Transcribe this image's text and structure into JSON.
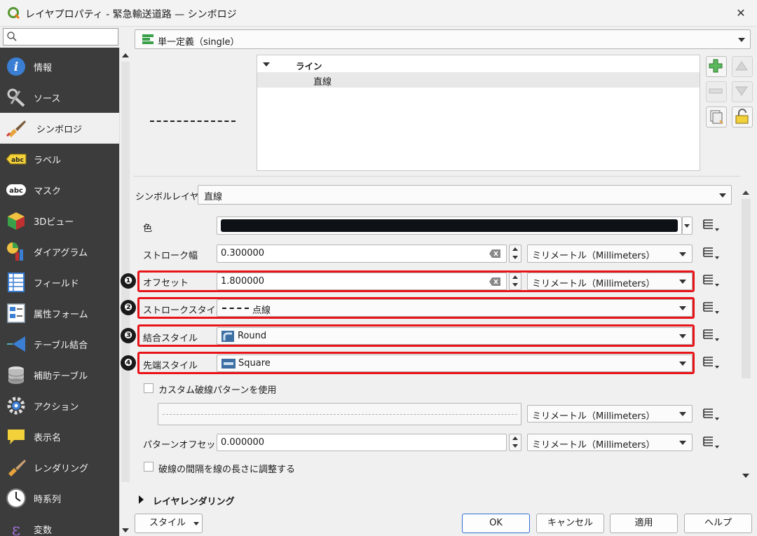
{
  "window": {
    "title": "レイヤプロパティ - 緊急輸送道路 — シンボロジ",
    "close_label": "✕"
  },
  "search": {
    "placeholder": ""
  },
  "sidebar": {
    "items": [
      {
        "label": "情報",
        "icon": "info-icon"
      },
      {
        "label": "ソース",
        "icon": "source-tools-icon"
      },
      {
        "label": "シンボロジ",
        "icon": "symbology-brush-icon",
        "active": true
      },
      {
        "label": "ラベル",
        "icon": "label-abc-icon"
      },
      {
        "label": "マスク",
        "icon": "mask-abc-icon"
      },
      {
        "label": "3Dビュー",
        "icon": "3d-cube-icon"
      },
      {
        "label": "ダイアグラム",
        "icon": "diagram-icon"
      },
      {
        "label": "フィールド",
        "icon": "fields-icon"
      },
      {
        "label": "属性フォーム",
        "icon": "attribute-form-icon"
      },
      {
        "label": "テーブル結合",
        "icon": "join-icon"
      },
      {
        "label": "補助テーブル",
        "icon": "auxiliary-storage-icon"
      },
      {
        "label": "アクション",
        "icon": "action-gear-icon"
      },
      {
        "label": "表示名",
        "icon": "display-tooltip-icon"
      },
      {
        "label": "レンダリング",
        "icon": "rendering-brush-icon"
      },
      {
        "label": "時系列",
        "icon": "temporal-clock-icon"
      },
      {
        "label": "変数",
        "icon": "variables-icon"
      }
    ]
  },
  "renderer": {
    "value": "単一定義（single）"
  },
  "symbol_tree": {
    "parent": "ライン",
    "child": "直線"
  },
  "symbol_layer": {
    "label": "シンボルレイヤ型",
    "value": "直線"
  },
  "props": {
    "color": {
      "label": "色",
      "value": "#0e1116"
    },
    "stroke_width": {
      "label": "ストローク幅",
      "value": "0.300000",
      "unit": "ミリメートル（Millimeters）"
    },
    "offset": {
      "label": "オフセット",
      "value": "1.800000",
      "unit": "ミリメートル（Millimeters）"
    },
    "stroke_style": {
      "label": "ストロークスタイル",
      "value": "点線"
    },
    "join_style": {
      "label": "結合スタイル",
      "value": "Round"
    },
    "cap_style": {
      "label": "先端スタイル",
      "value": "Square"
    },
    "custom_dash": {
      "label": "カスタム破線パターンを使用",
      "checked": false,
      "unit": "ミリメートル（Millimeters）"
    },
    "pattern_offset": {
      "label": "パターンオフセット",
      "value": "0.000000",
      "unit": "ミリメートル（Millimeters）"
    },
    "align_dash": {
      "label": "破線の間隔を線の長さに調整する",
      "checked": false
    }
  },
  "badges": [
    "❶",
    "❷",
    "❸",
    "❹"
  ],
  "layer_rendering": {
    "label": "レイヤレンダリング"
  },
  "buttons": {
    "style": "スタイル",
    "ok": "OK",
    "cancel": "キャンセル",
    "apply": "適用",
    "help": "ヘルプ"
  },
  "colors": {
    "highlight": "#e8141a",
    "sidebar_bg": "#3c3c3c",
    "accent": "#2e6fd1"
  }
}
